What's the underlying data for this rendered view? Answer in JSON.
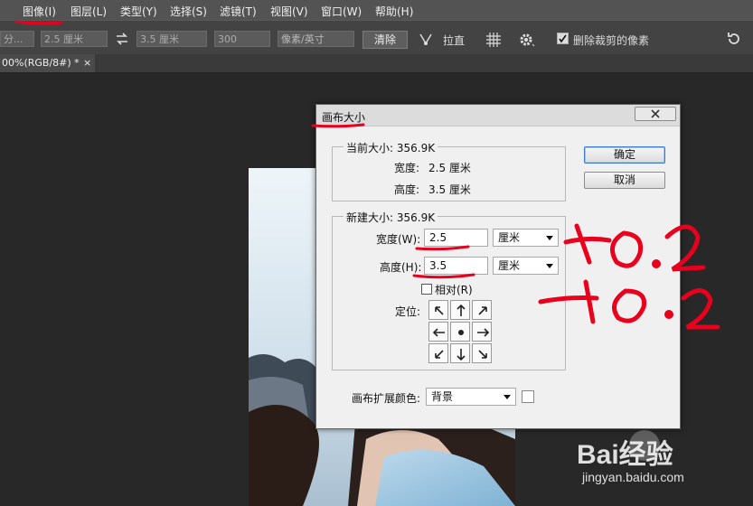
{
  "menubar": {
    "items": [
      "图像(I)",
      "图层(L)",
      "类型(Y)",
      "选择(S)",
      "滤镜(T)",
      "视图(V)",
      "窗口(W)",
      "帮助(H)"
    ]
  },
  "options": {
    "unit_field": "分...",
    "width_value": "2.5 厘米",
    "height_value": "3.5 厘米",
    "resolution_value": "300",
    "resolution_unit": "像素/英寸",
    "clear_label": "清除",
    "straighten_label": "拉直",
    "delete_cropped_label": "删除裁剪的像素",
    "delete_cropped_checked": true
  },
  "document_tab": {
    "label": "00%(RGB/8#) *",
    "close": "×"
  },
  "dialog": {
    "title": "画布大小",
    "current_size": {
      "legend": "当前大小: 356.9K",
      "width_label": "宽度:",
      "width_value": "2.5 厘米",
      "height_label": "高度:",
      "height_value": "3.5 厘米"
    },
    "new_size": {
      "legend": "新建大小: 356.9K",
      "width_label": "宽度(W):",
      "width_value": "2.5",
      "width_unit": "厘米",
      "height_label": "高度(H):",
      "height_value": "3.5",
      "height_unit": "厘米",
      "relative_label": "相对(R)",
      "relative_checked": false,
      "anchor_label": "定位:"
    },
    "canvas_ext_color_label": "画布扩展颜色:",
    "canvas_ext_color_value": "背景",
    "ok_label": "确定",
    "cancel_label": "取消"
  },
  "annotation": {
    "plus_width": "+0.2",
    "plus_height": "+0.2",
    "color": "#e8001c"
  },
  "watermark": {
    "brand": "Bai经验",
    "url": "jingyan.baidu.com"
  },
  "colors": {
    "menubar": "#535353",
    "optbar": "#434343",
    "workspace": "#282828",
    "dialog_bg": "#f0f0f0",
    "accent": "#3d7bd0"
  }
}
